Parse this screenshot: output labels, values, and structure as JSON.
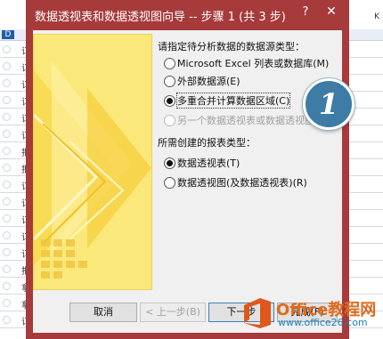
{
  "sheet": {
    "col_header_right": "K",
    "col_header_left": "D",
    "row_chars": [
      "订",
      "订",
      "订",
      "订",
      "订",
      "订",
      "批",
      "批",
      "订",
      "订",
      "订",
      "订",
      "订",
      "批",
      "拿",
      "拿",
      "订"
    ]
  },
  "dialog": {
    "title": "数据透视表和数据透视图向导 -- 步骤 1 (共 3 步)",
    "help": "?",
    "close": "✕",
    "source_group_label": "请指定待分析数据的数据源类型：",
    "source_options": [
      {
        "label": "Microsoft Excel 列表或数据库(M)",
        "checked": false,
        "disabled": false
      },
      {
        "label": "外部数据源(E)",
        "checked": false,
        "disabled": false
      },
      {
        "label": "多重合并计算数据区域(C)",
        "checked": true,
        "disabled": false
      },
      {
        "label": "另一个数据透视表或数据透视图",
        "checked": false,
        "disabled": true
      }
    ],
    "report_group_label": "所需创建的报表类型：",
    "report_options": [
      {
        "label": "数据透视表(T)",
        "checked": true
      },
      {
        "label": "数据透视图(及数据透视表)(R)",
        "checked": false
      }
    ],
    "buttons": {
      "cancel": "取消",
      "back": "< 上一步(B)",
      "next": "下一步",
      "finish": "完成(F)"
    }
  },
  "badge": {
    "text": "1"
  },
  "watermark": {
    "name": "Office教程网",
    "url": "www.office26.com"
  },
  "colors": {
    "titlebar": "#a73a3a",
    "badge": "#3e7ca6",
    "art": "#fbe87a"
  }
}
